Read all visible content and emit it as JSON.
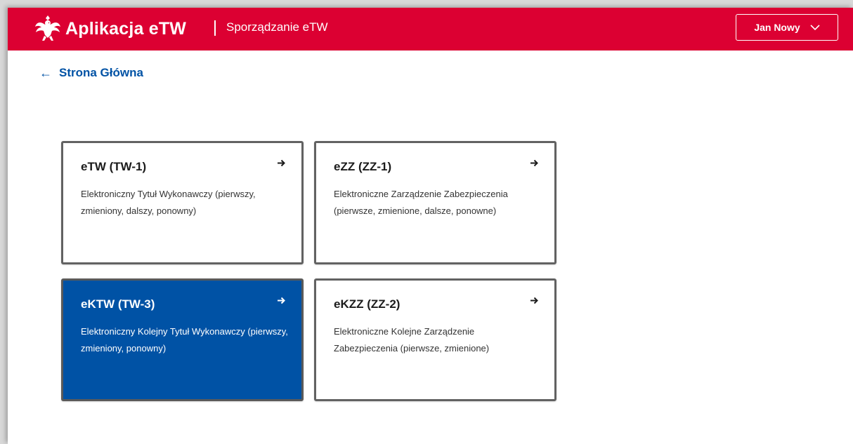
{
  "header": {
    "app_title": "Aplikacja eTW",
    "section_title": "Sporządzanie eTW",
    "user_name": "Jan Nowy",
    "background_color": "#dc0032"
  },
  "navigation": {
    "back_label": "Strona Główna"
  },
  "cards": [
    {
      "title": "eTW (TW-1)",
      "description": "Elektroniczny Tytuł Wykonawczy (pierwszy, zmieniony, dalszy, ponowny)",
      "active": false
    },
    {
      "title": "eZZ (ZZ-1)",
      "description": "Elektroniczne Zarządzenie Zabezpieczenia (pierwsze, zmienione, dalsze, ponowne)",
      "active": false
    },
    {
      "title": "eKTW (TW-3)",
      "description": "Elektroniczny Kolejny Tytuł Wykonawczy (pierwszy, zmieniony, ponowny)",
      "active": true
    },
    {
      "title": "eKZZ (ZZ-2)",
      "description": "Elektroniczne Kolejne Zarządzenie Zabezpieczenia (pierwsze, zmienione)",
      "active": false
    }
  ],
  "icons": {
    "logo": "polish-eagle-icon",
    "back": "arrow-left-icon",
    "card_arrow": "arrow-right-icon",
    "user_menu": "chevron-down-icon"
  },
  "colors": {
    "accent_blue": "#0052a5",
    "card_border": "#626262"
  }
}
